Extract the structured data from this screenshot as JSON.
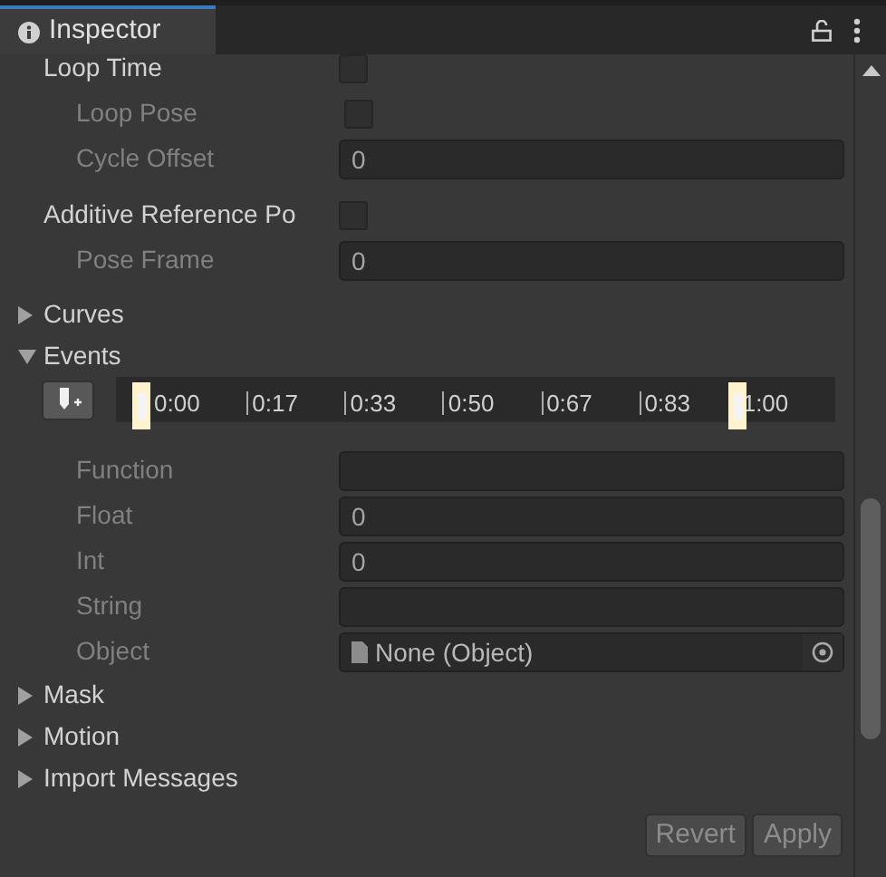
{
  "tab": {
    "title": "Inspector",
    "selected": true
  },
  "setting_groups": [
    [
      {
        "kind": "checkbox",
        "label": "Loop Time",
        "indented": false,
        "disabled": false,
        "checked": false
      },
      {
        "kind": "checkbox",
        "label": "Loop Pose",
        "indented": true,
        "disabled": true,
        "checked": false
      },
      {
        "kind": "field",
        "label": "Cycle Offset",
        "indented": true,
        "disabled": true,
        "value": "0"
      }
    ],
    [
      {
        "kind": "checkbox",
        "label": "Additive Reference Po",
        "indented": false,
        "disabled": false,
        "checked": false
      },
      {
        "kind": "field",
        "label": "Pose Frame",
        "indented": true,
        "disabled": true,
        "value": "0"
      }
    ]
  ],
  "foldouts": [
    {
      "label": "Curves",
      "expanded": false
    },
    {
      "label": "Events",
      "expanded": true
    }
  ],
  "events": {
    "timeline_labels": [
      "0:00",
      "0:17",
      "0:33",
      "0:50",
      "0:67",
      "0:83",
      "1:00"
    ],
    "fields": [
      {
        "kind": "field",
        "label": "Function",
        "indented": true,
        "disabled": true
      },
      {
        "kind": "field",
        "label": "Float",
        "indented": true,
        "disabled": true,
        "value": "0"
      },
      {
        "kind": "field",
        "label": "Int",
        "indented": true,
        "disabled": true,
        "value": "0"
      },
      {
        "kind": "field",
        "label": "String",
        "indented": true,
        "disabled": true
      },
      {
        "kind": "object",
        "label": "Object",
        "indented": true,
        "disabled": true,
        "value": "None (Object)"
      }
    ]
  },
  "more_foldouts": [
    {
      "label": "Mask",
      "expanded": false
    },
    {
      "label": "Motion",
      "expanded": false
    },
    {
      "label": "Import Messages",
      "expanded": false
    }
  ],
  "buttons": [
    "Revert",
    "Apply"
  ]
}
